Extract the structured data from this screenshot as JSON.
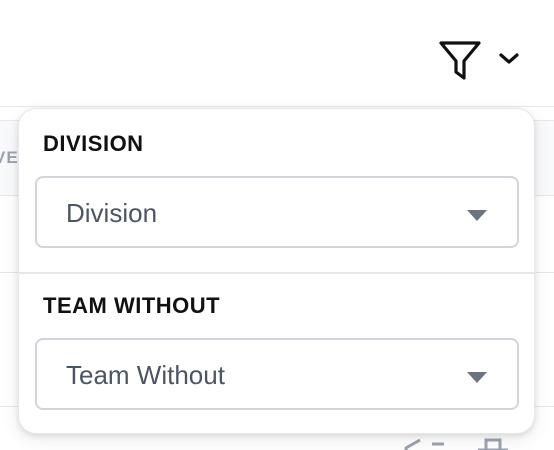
{
  "toolbar": {
    "filter_icon": "filter-funnel-icon",
    "chevron_icon": "chevron-down-icon"
  },
  "background_table": {
    "partial_header_text": "VE"
  },
  "filter_panel": {
    "division": {
      "label": "DIVISION",
      "placeholder": "Division"
    },
    "team_without": {
      "label": "TEAM WITHOUT",
      "placeholder": "Team Without"
    }
  },
  "colors": {
    "border": "#d1d5db",
    "text_muted": "#4b5563",
    "heading": "#111111"
  }
}
